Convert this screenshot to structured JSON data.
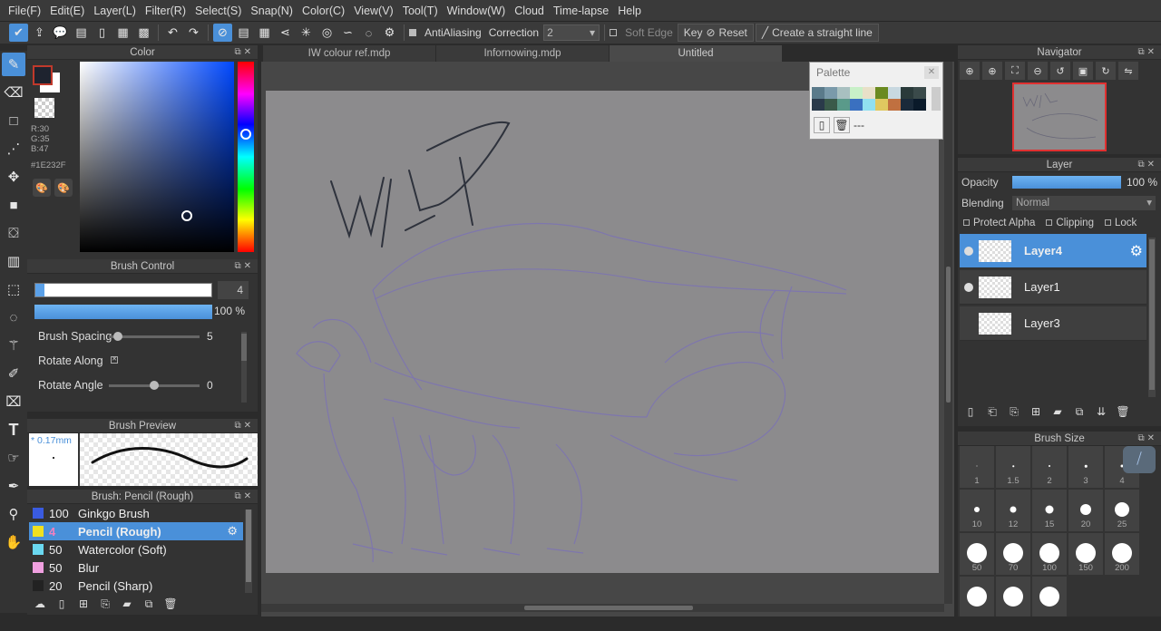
{
  "menu": [
    "File(F)",
    "Edit(E)",
    "Layer(L)",
    "Filter(R)",
    "Select(S)",
    "Snap(N)",
    "Color(C)",
    "View(V)",
    "Tool(T)",
    "Window(W)",
    "Cloud",
    "Time-lapse",
    "Help"
  ],
  "toolbar": {
    "antialiasing": "AntiAliasing",
    "correction_label": "Correction",
    "correction_value": "2",
    "soft_edge": "Soft Edge",
    "key": "Key",
    "reset": "Reset",
    "straight_line": "Create a straight line"
  },
  "color": {
    "title": "Color",
    "r": "R:30",
    "g": "G:35",
    "b": "B:47",
    "hex": "#1E232F",
    "fg_color": "#1E232F",
    "bg_color": "#FFFFFF"
  },
  "brush_control": {
    "title": "Brush Control",
    "size_value": "4",
    "opacity_value": "100 %",
    "rows": [
      {
        "label": "Brush Spacing",
        "value": "5",
        "knob_fraction": 0.05
      },
      {
        "label": "Rotate Along",
        "value": ""
      },
      {
        "label": "Rotate Angle",
        "value": "0",
        "knob_fraction": 0.5
      }
    ]
  },
  "brush_preview": {
    "title": "Brush Preview",
    "size_mm": "* 0.17mm"
  },
  "brush_list": {
    "title": "Brush: Pencil (Rough)",
    "items": [
      {
        "size": "100",
        "name": "Ginkgo Brush",
        "color": "#3a5be0",
        "selected": false
      },
      {
        "size": "4",
        "name": "Pencil (Rough)",
        "color": "#f0e020",
        "selected": true
      },
      {
        "size": "50",
        "name": "Watercolor (Soft)",
        "color": "#6ad8f0",
        "selected": false
      },
      {
        "size": "50",
        "name": "Blur",
        "color": "#f0a0e0",
        "selected": false
      },
      {
        "size": "20",
        "name": "Pencil (Sharp)",
        "color": "#222222",
        "selected": false
      }
    ]
  },
  "tabs": [
    {
      "label": "IW colour ref.mdp",
      "active": false
    },
    {
      "label": "Infornowing.mdp",
      "active": false
    },
    {
      "label": "Untitled",
      "active": true
    }
  ],
  "palette": {
    "title": "Palette",
    "footer_text": "---",
    "swatches": [
      "#5a7a8a",
      "#7a9aaa",
      "#a8c0c0",
      "#c8f0c8",
      "#e8e0c8",
      "#6a8a20",
      "#c8d8e0",
      "#2a3a3a",
      "#3a4a4a",
      "#2a3a4a",
      "#3a5a4a",
      "#5a9a8a",
      "#3a70c0",
      "#90e0f0",
      "#e0c860",
      "#c07040",
      "#1a2a3a",
      "#0a1a2a"
    ]
  },
  "navigator": {
    "title": "Navigator"
  },
  "layer": {
    "title": "Layer",
    "opacity_label": "Opacity",
    "opacity_value": "100 %",
    "blending_label": "Blending",
    "blending_value": "Normal",
    "protect_alpha": "Protect Alpha",
    "clipping": "Clipping",
    "lock": "Lock",
    "layers": [
      {
        "name": "Layer4",
        "selected": true,
        "visible": true
      },
      {
        "name": "Layer1",
        "selected": false,
        "visible": true
      },
      {
        "name": "Layer3",
        "selected": false,
        "visible": false
      }
    ]
  },
  "brush_size": {
    "title": "Brush Size",
    "sizes": [
      {
        "label": "1",
        "d": 1
      },
      {
        "label": "1.5",
        "d": 1.5
      },
      {
        "label": "2",
        "d": 2
      },
      {
        "label": "3",
        "d": 2.5
      },
      {
        "label": "4",
        "d": 3
      },
      {
        "label": "10",
        "d": 6
      },
      {
        "label": "12",
        "d": 7
      },
      {
        "label": "15",
        "d": 9
      },
      {
        "label": "20",
        "d": 12
      },
      {
        "label": "25",
        "d": 16
      },
      {
        "label": "50",
        "d": 22
      },
      {
        "label": "70",
        "d": 22
      },
      {
        "label": "100",
        "d": 22
      },
      {
        "label": "150",
        "d": 22
      },
      {
        "label": "200",
        "d": 22
      },
      {
        "label": "",
        "d": 22
      },
      {
        "label": "",
        "d": 22
      },
      {
        "label": "",
        "d": 22
      }
    ]
  }
}
